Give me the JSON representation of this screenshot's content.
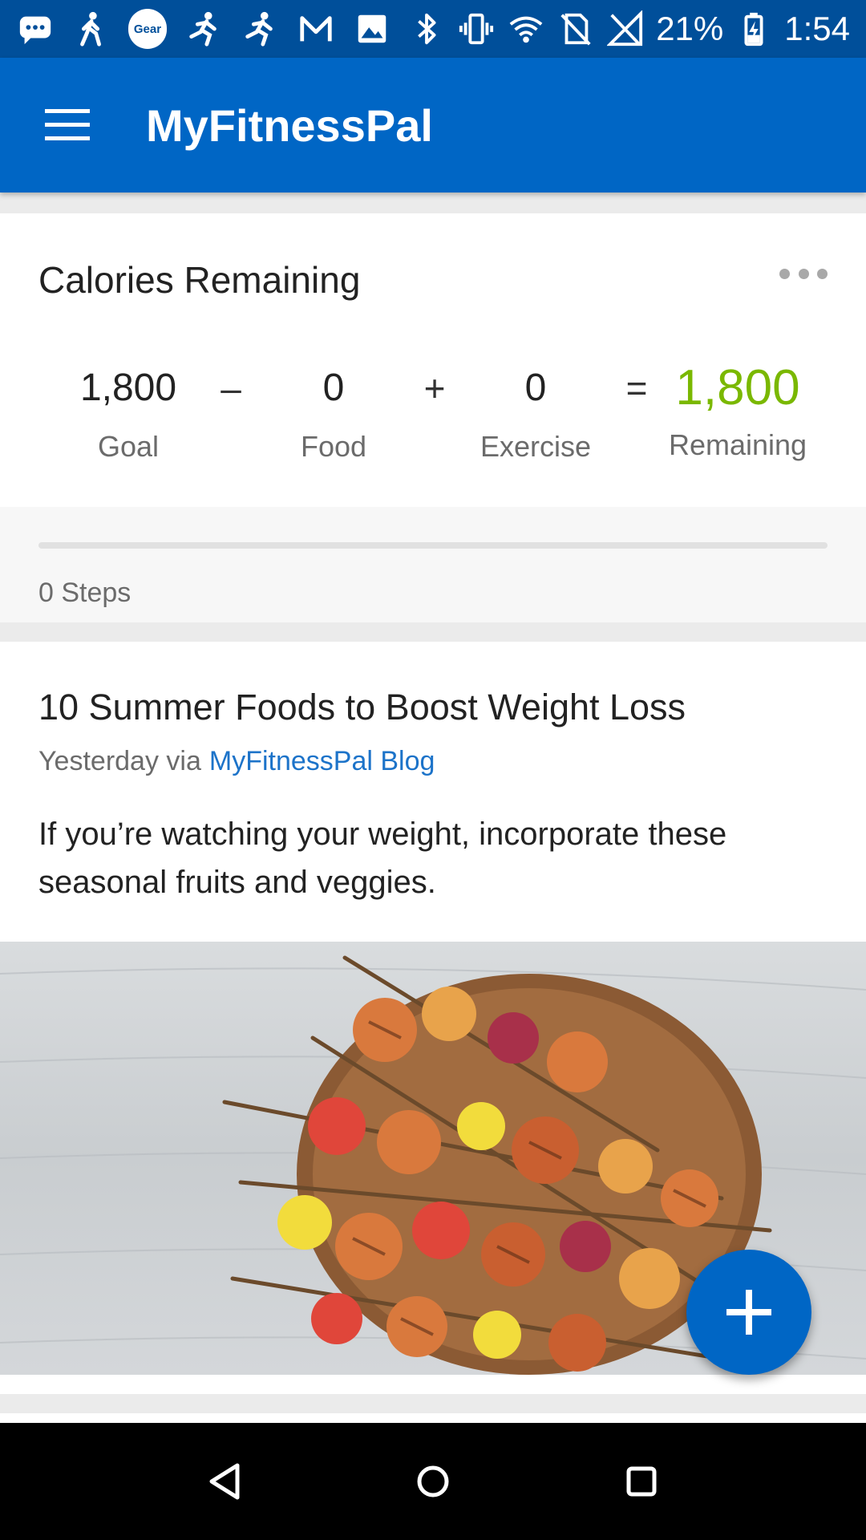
{
  "status_bar": {
    "gear_label": "Gear",
    "battery": "21%",
    "time": "1:54"
  },
  "app_bar": {
    "title": "MyFitnessPal"
  },
  "calories": {
    "header": "Calories Remaining",
    "goal_value": "1,800",
    "goal_label": "Goal",
    "minus": "–",
    "food_value": "0",
    "food_label": "Food",
    "plus": "+",
    "exercise_value": "0",
    "exercise_label": "Exercise",
    "equals": "=",
    "remaining_value": "1,800",
    "remaining_label": "Remaining",
    "remaining_color": "#7ab800"
  },
  "steps": {
    "label": "0 Steps",
    "progress": 0
  },
  "article": {
    "title": "10 Summer Foods to Boost Weight Loss",
    "meta_prefix": "Yesterday via",
    "source": "MyFitnessPal Blog",
    "body": "If you’re watching your weight, incorporate these seasonal fruits and veggies.",
    "image_icon": "grilled-skewers-photo"
  },
  "fab": {
    "icon": "plus-icon"
  },
  "colors": {
    "brand_blue": "#0066c5",
    "status_blue": "#004f9a",
    "link_blue": "#1c73c9"
  }
}
